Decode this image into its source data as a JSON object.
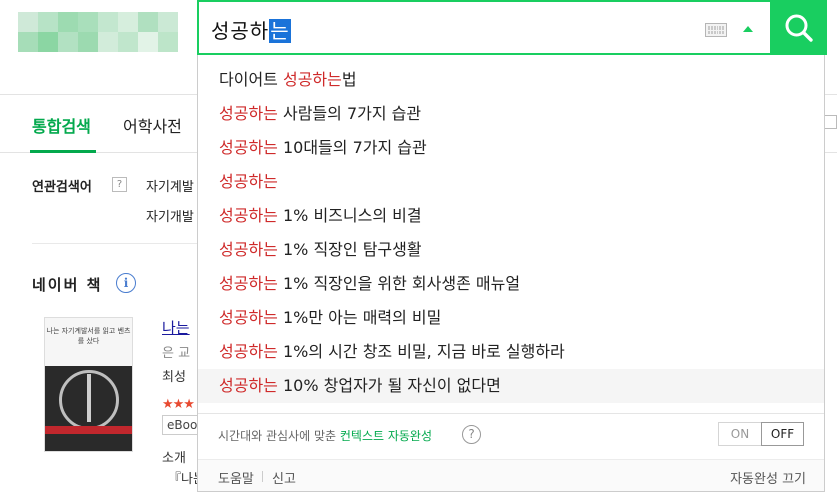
{
  "search": {
    "query_typed": "성공하",
    "query_selected": "는"
  },
  "page": {
    "tabs": [
      {
        "label": "통합검색"
      },
      {
        "label": "어학사전"
      }
    ],
    "related_label": "연관검색어",
    "related_help": "?",
    "related_items": [
      "자기계발",
      "자기개발"
    ],
    "book_section_title": "네이버 책",
    "book": {
      "cover_text": "나는 자기계발서를 읽고 벤츠를 샀다",
      "title": "나는",
      "line2": "은 교",
      "author": "최성",
      "stars": "★★★",
      "ebook_tag": "eBoo",
      "intro_label": "소개",
      "intro_text": "『나는"
    }
  },
  "autocomplete": {
    "items": [
      {
        "prefix": "다이어트 ",
        "match": "성공하는",
        "suffix": "법"
      },
      {
        "prefix": "",
        "match": "성공하는",
        "suffix": " 사람들의 7가지 습관"
      },
      {
        "prefix": "",
        "match": "성공하는",
        "suffix": " 10대들의 7가지 습관"
      },
      {
        "prefix": "",
        "match": "성공하는",
        "suffix": ""
      },
      {
        "prefix": "",
        "match": "성공하는",
        "suffix": " 1% 비즈니스의 비결"
      },
      {
        "prefix": "",
        "match": "성공하는",
        "suffix": " 1% 직장인 탐구생활"
      },
      {
        "prefix": "",
        "match": "성공하는",
        "suffix": " 1% 직장인을 위한 회사생존 매뉴얼"
      },
      {
        "prefix": "",
        "match": "성공하는",
        "suffix": " 1%만 아는 매력의 비밀"
      },
      {
        "prefix": "",
        "match": "성공하는",
        "suffix": " 1%의 시간 창조 비밀, 지금 바로 실행하라"
      },
      {
        "prefix": "",
        "match": "성공하는",
        "suffix": " 10% 창업자가 될 자신이 없다면"
      }
    ],
    "context_text": "시간대와 관심사에 맞춘 ",
    "context_link": "컨텍스트 자동완성",
    "context_help": "?",
    "toggle_on": "ON",
    "toggle_off": "OFF",
    "help": "도움말",
    "report": "신고",
    "turn_off": "자동완성 끄기"
  },
  "colors": {
    "brand_green": "#19ce60",
    "match_red": "#cf2a2a"
  }
}
